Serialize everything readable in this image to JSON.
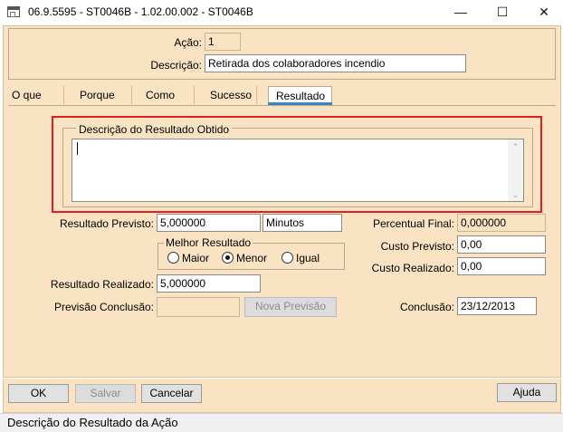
{
  "window": {
    "title": "06.9.5595 - ST0046B - 1.02.00.002 - ST0046B",
    "controls": {
      "minimize": "—",
      "maximize": "☐",
      "close": "✕"
    }
  },
  "header": {
    "acao_label": "Ação:",
    "acao_value": "1",
    "descricao_label": "Descrição:",
    "descricao_value": "Retirada dos colaboradores incendio"
  },
  "tabs": [
    {
      "label": "O que"
    },
    {
      "label": "Porque"
    },
    {
      "label": "Como"
    },
    {
      "label": "Sucesso"
    },
    {
      "label": "Resultado",
      "active": true
    }
  ],
  "result_group": {
    "title": "Descrição do Resultado Obtido",
    "value": ""
  },
  "form": {
    "resultado_previsto_label": "Resultado Previsto:",
    "resultado_previsto_value": "5,000000",
    "unidade_value": "Minutos",
    "melhor_resultado_title": "Melhor Resultado",
    "radio_maior": "Maior",
    "radio_menor": "Menor",
    "radio_igual": "Igual",
    "selected": "Menor",
    "resultado_realizado_label": "Resultado Realizado:",
    "resultado_realizado_value": "5,000000",
    "previsao_conclusao_label": "Previsão Conclusão:",
    "previsao_conclusao_value": "",
    "nova_previsao_label": "Nova Previsão",
    "percentual_final_label": "Percentual Final:",
    "percentual_final_value": "0,000000",
    "custo_previsto_label": "Custo Previsto:",
    "custo_previsto_value": "0,00",
    "custo_realizado_label": "Custo Realizado:",
    "custo_realizado_value": "0,00",
    "conclusao_label": "Conclusão:",
    "conclusao_value": "23/12/2013"
  },
  "buttons": {
    "ok": "OK",
    "salvar": "Salvar",
    "cancelar": "Cancelar",
    "ajuda": "Ajuda"
  },
  "status": {
    "text": "Descrição do Resultado da Ação"
  },
  "colors": {
    "panel_bg": "#fae3c3",
    "highlight": "#e02020",
    "active_tab_accent": "#3b82c6"
  }
}
